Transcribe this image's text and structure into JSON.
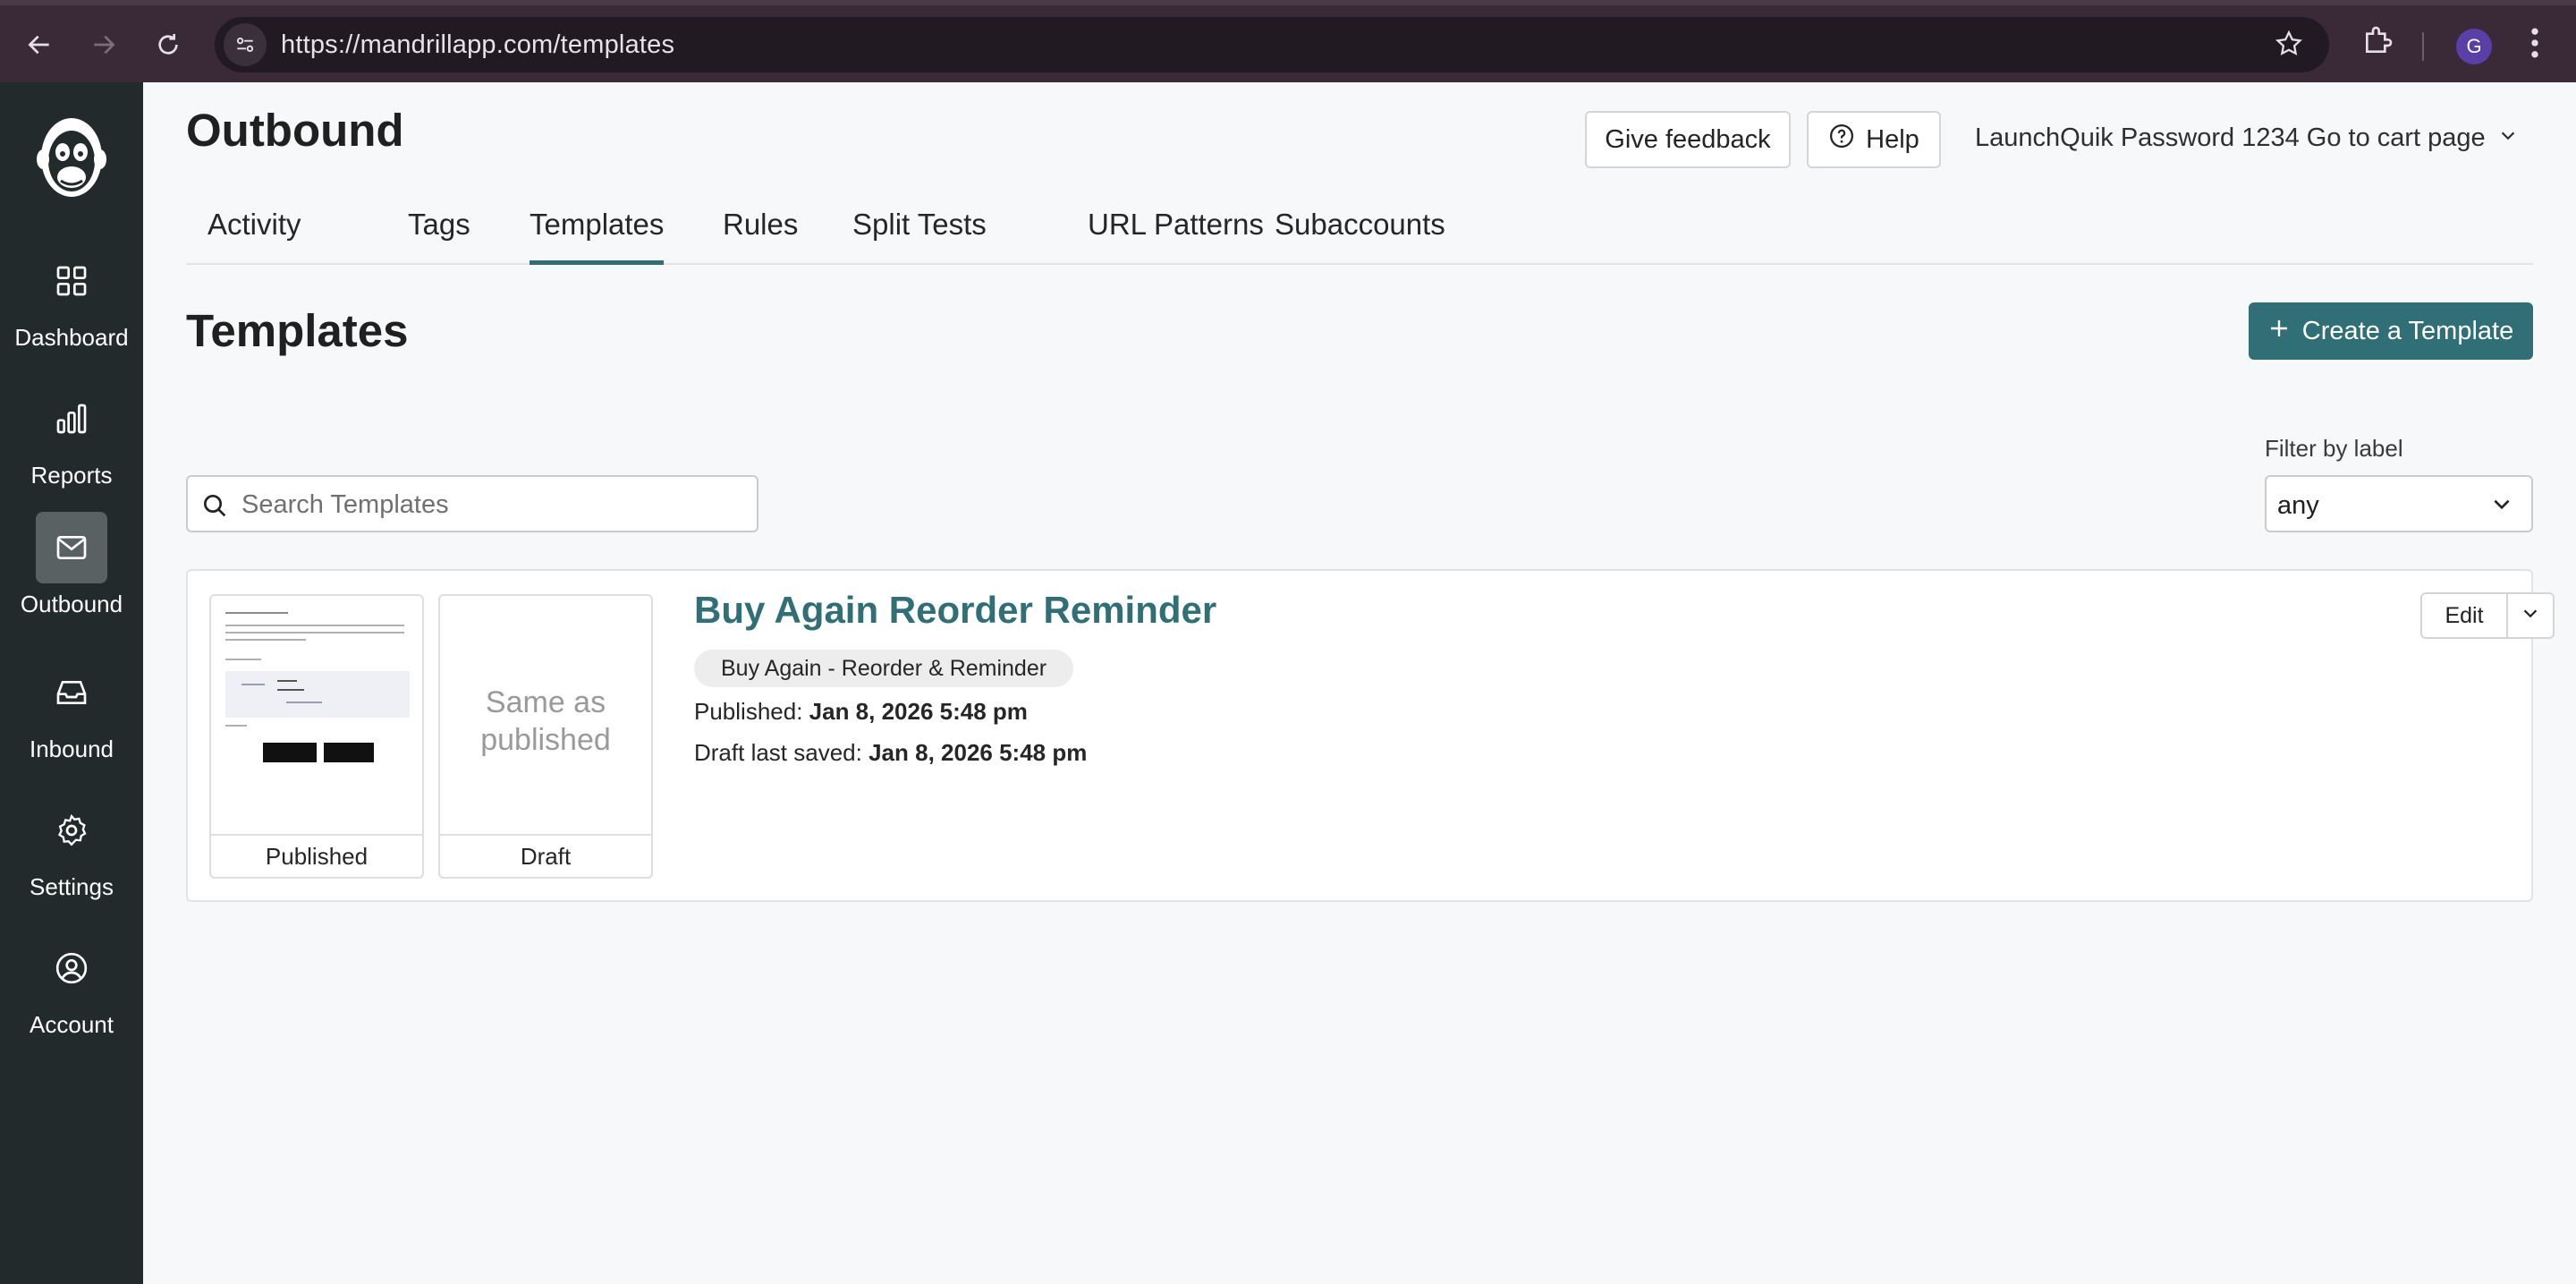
{
  "browser": {
    "url": "https://mandrillapp.com/templates",
    "profile_initial": "G"
  },
  "sidebar": {
    "items": [
      {
        "label": "Dashboard",
        "icon": "dashboard-grid-icon"
      },
      {
        "label": "Reports",
        "icon": "bar-chart-icon"
      },
      {
        "label": "Outbound",
        "icon": "mail-icon",
        "active": true
      },
      {
        "label": "Inbound",
        "icon": "inbox-icon"
      },
      {
        "label": "Settings",
        "icon": "gear-icon"
      },
      {
        "label": "Account",
        "icon": "user-circle-icon"
      }
    ]
  },
  "header": {
    "title": "Outbound",
    "feedback_label": "Give feedback",
    "help_label": "Help",
    "account_name": "LaunchQuik Password 1234 Go to cart page"
  },
  "tabs": [
    {
      "label": "Activity"
    },
    {
      "label": "Tags"
    },
    {
      "label": "Templates",
      "active": true
    },
    {
      "label": "Rules"
    },
    {
      "label": "Split Tests"
    },
    {
      "label": "URL Patterns"
    },
    {
      "label": "Subaccounts"
    }
  ],
  "templates_section": {
    "title": "Templates",
    "create_label": "Create a Template",
    "search_placeholder": "Search Templates",
    "filter_label": "Filter by label",
    "filter_value": "any"
  },
  "template": {
    "name": "Buy Again Reorder Reminder",
    "label": "Buy Again - Reorder & Reminder",
    "published_prefix": "Published:",
    "published_date": "Jan 8, 2026 5:48 pm",
    "draft_prefix": "Draft last saved:",
    "draft_date": "Jan 8, 2026 5:48 pm",
    "published_caption": "Published",
    "draft_caption": "Draft",
    "draft_preview_text": "Same as published",
    "edit_label": "Edit"
  },
  "colors": {
    "accent": "#2f6f75",
    "sidebar_bg": "#222a2b",
    "chrome_bg": "#3a2a38"
  }
}
